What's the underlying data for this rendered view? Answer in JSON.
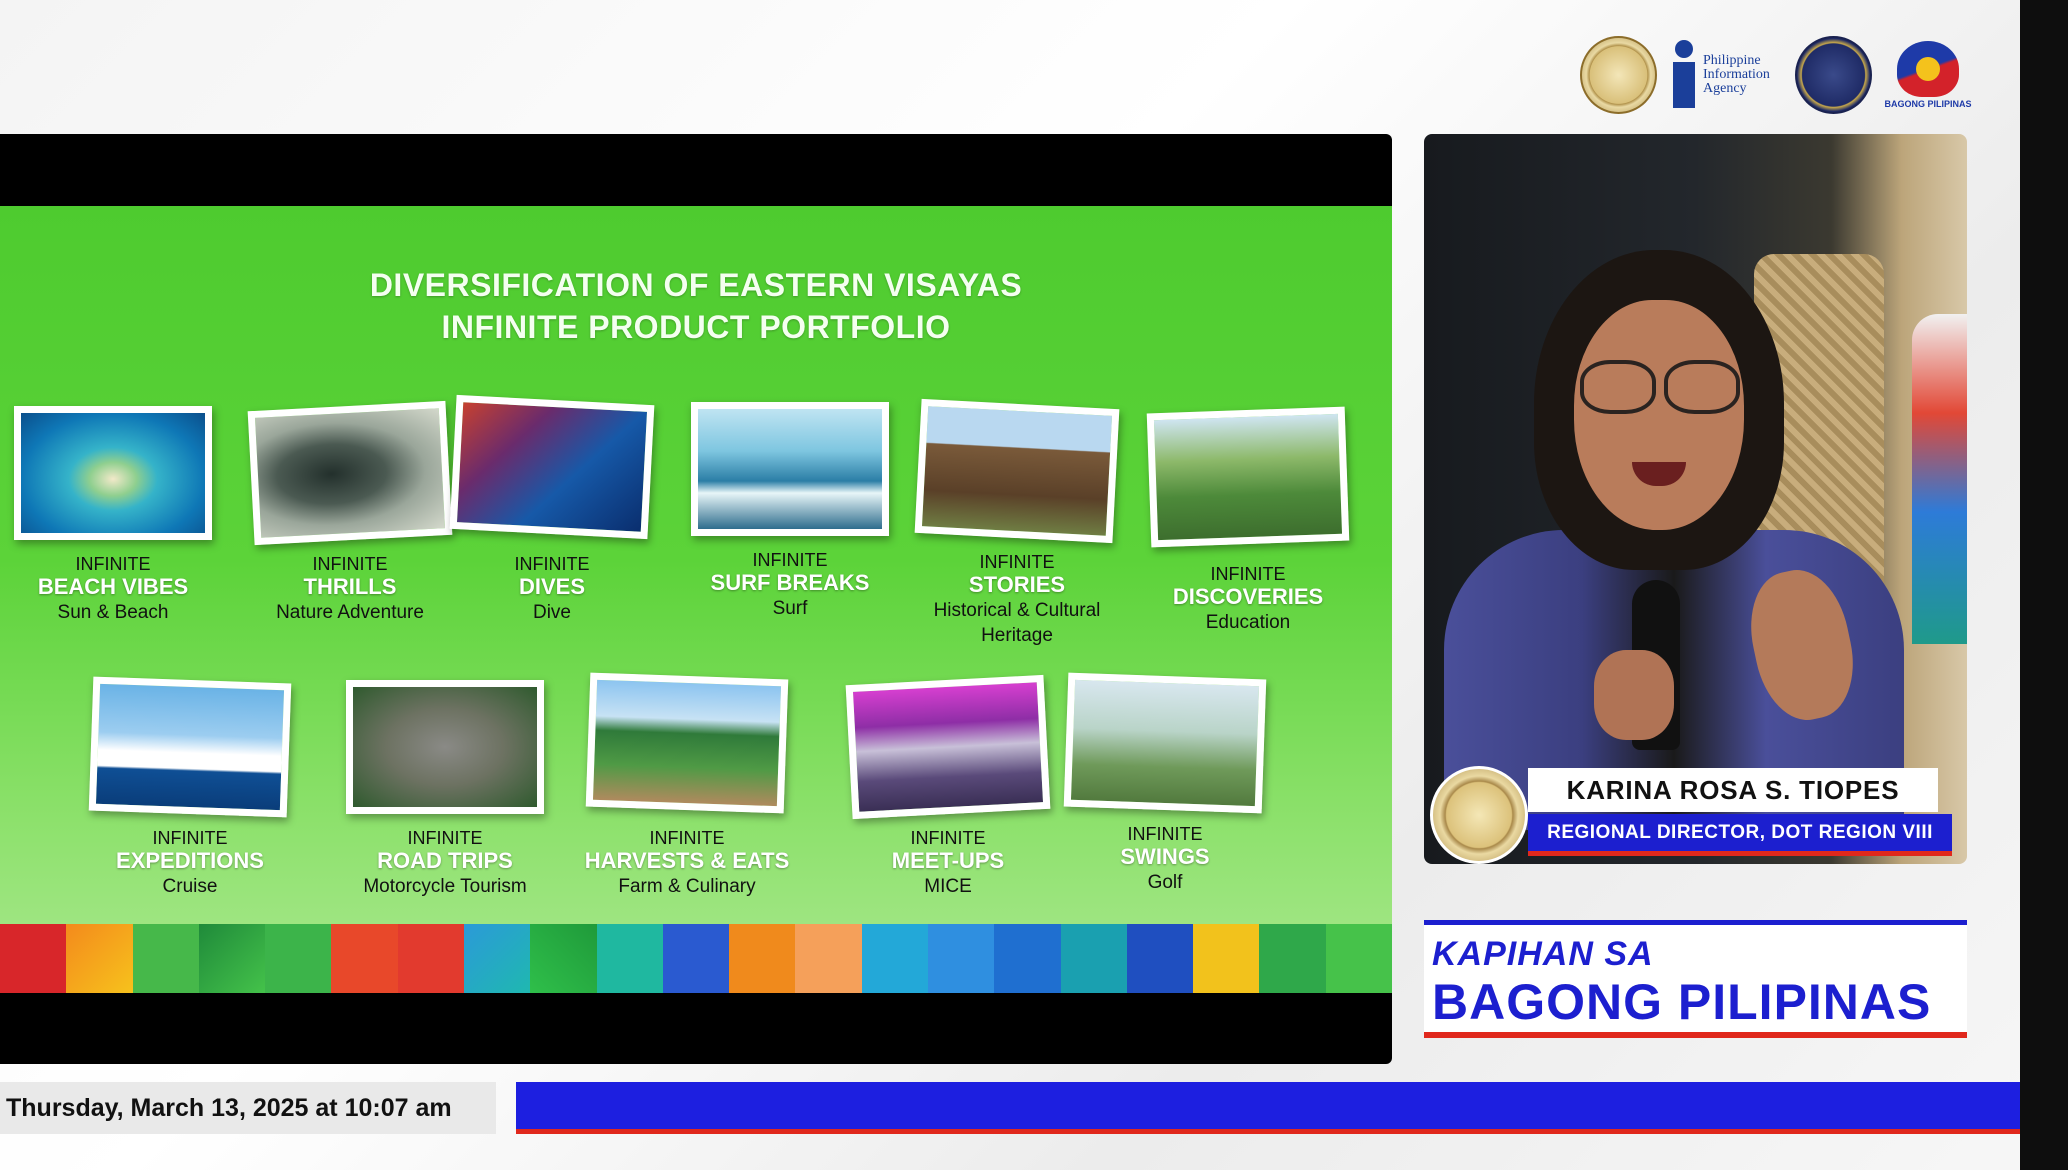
{
  "logos": {
    "pia_name": "Philippine Information Agency",
    "bagong_pilipinas_label": "BAGONG PILIPINAS"
  },
  "slide": {
    "title_line1": "DIVERSIFICATION OF EASTERN VISAYAS",
    "title_line2": "INFINITE PRODUCT PORTFOLIO",
    "products": [
      {
        "prefix": "INFINITE",
        "name": "BEACH VIBES",
        "sub": "Sun & Beach"
      },
      {
        "prefix": "INFINITE",
        "name": "THRILLS",
        "sub": "Nature Adventure"
      },
      {
        "prefix": "INFINITE",
        "name": "DIVES",
        "sub": "Dive"
      },
      {
        "prefix": "INFINITE",
        "name": "SURF BREAKS",
        "sub": "Surf"
      },
      {
        "prefix": "INFINITE",
        "name": "STORIES",
        "sub": "Historical & Cultural Heritage"
      },
      {
        "prefix": "INFINITE",
        "name": "DISCOVERIES",
        "sub": "Education"
      },
      {
        "prefix": "INFINITE",
        "name": "EXPEDITIONS",
        "sub": "Cruise"
      },
      {
        "prefix": "INFINITE",
        "name": "ROAD TRIPS",
        "sub": "Motorcycle Tourism"
      },
      {
        "prefix": "INFINITE",
        "name": "HARVESTS & EATS",
        "sub": "Farm & Culinary"
      },
      {
        "prefix": "INFINITE",
        "name": "MEET-UPS",
        "sub": "MICE"
      },
      {
        "prefix": "INFINITE",
        "name": "SWINGS",
        "sub": "Golf"
      }
    ]
  },
  "broadcast": {
    "datetime": "Thursday, March 13, 2025 at 10:07 am"
  },
  "speaker": {
    "name": "KARINA ROSA S. TIOPES",
    "title": "REGIONAL DIRECTOR, DOT REGION VIII"
  },
  "program": {
    "line1": "KAPIHAN SA",
    "line2": "BAGONG PILIPINAS"
  },
  "colors": {
    "brand_blue": "#1c1fcf",
    "brand_red": "#e0281c",
    "slide_green": "#5cd339"
  }
}
